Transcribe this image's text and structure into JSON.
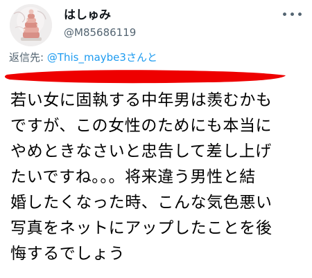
{
  "author": {
    "display_name": "はしゅみ",
    "handle": "@M85686119"
  },
  "reply": {
    "label": "返信先: ",
    "mention": "@This_maybe3さんと"
  },
  "tweet": {
    "lines": [
      "若い女に固執する中年男は羨むかも",
      "ですが、この女性のためにも本当に",
      "やめときなさいと忠告して差し上げ",
      "たいですね。。。将来違う男性と結",
      "婚したくなった時、こんな気色悪い",
      "写真をネットにアップしたことを後",
      "悔するでしょう"
    ]
  },
  "icons": {
    "avatar": "avatar-cake-photo",
    "more": "more-horizontal-icon"
  },
  "colors": {
    "text": "#0f1419",
    "secondary": "#536471",
    "link": "#1d9bf0",
    "redaction": "#ee0000"
  }
}
